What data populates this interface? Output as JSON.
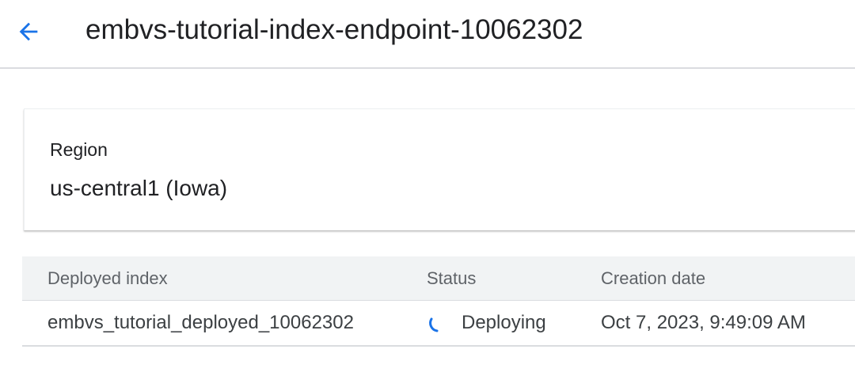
{
  "header": {
    "title": "embvs-tutorial-index-endpoint-10062302",
    "back_icon": "arrow-back-icon"
  },
  "colors": {
    "accent": "#1a73e8",
    "text": "#202124",
    "muted": "#5f6368",
    "divider": "#dadce0",
    "table_header_bg": "#f1f3f4"
  },
  "details": {
    "region_label": "Region",
    "region_value": "us-central1 (Iowa)"
  },
  "table": {
    "columns": [
      "Deployed index",
      "Status",
      "Creation date"
    ],
    "rows": [
      {
        "deployed_index": "embvs_tutorial_deployed_10062302",
        "status": "Deploying",
        "status_icon": "progress-spinner-icon",
        "creation_date": "Oct 7, 2023, 9:49:09 AM"
      }
    ]
  }
}
